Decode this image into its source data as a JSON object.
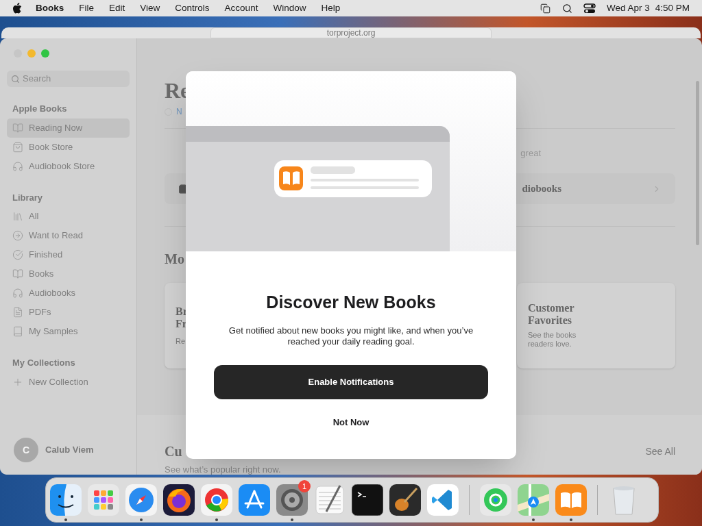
{
  "menu_bar": {
    "app": "Books",
    "items": [
      "File",
      "Edit",
      "View",
      "Controls",
      "Account",
      "Window",
      "Help"
    ],
    "date": "Wed Apr 3",
    "time": "4:50 PM"
  },
  "background_window": {
    "url": "torproject.org"
  },
  "sidebar": {
    "search": {
      "placeholder": "Search"
    },
    "sections": [
      {
        "title": "Apple Books",
        "items": [
          {
            "label": "Reading Now",
            "selected": true
          },
          {
            "label": "Book Store",
            "selected": false
          },
          {
            "label": "Audiobook Store",
            "selected": false
          }
        ]
      },
      {
        "title": "Library",
        "items": [
          {
            "label": "All",
            "selected": false
          },
          {
            "label": "Want to Read",
            "selected": false
          },
          {
            "label": "Finished",
            "selected": false
          },
          {
            "label": "Books",
            "selected": false
          },
          {
            "label": "Audiobooks",
            "selected": false
          },
          {
            "label": "PDFs",
            "selected": false
          },
          {
            "label": "My Samples",
            "selected": false
          }
        ]
      },
      {
        "title": "My Collections",
        "items": [
          {
            "label": "New Collection",
            "selected": false
          }
        ]
      }
    ],
    "user": {
      "initial": "C",
      "name": "Calub Viem"
    }
  },
  "content": {
    "heading": "Re",
    "link": "N",
    "intro_tail": "great",
    "store_row": "diobooks",
    "section_heading": "Mo",
    "card_left": {
      "title_lines": [
        "Br",
        "Fr"
      ],
      "text": "Re"
    },
    "card_right": {
      "title": "Customer Favorites",
      "text": "See the books readers love."
    },
    "bottom_heading": "Cu",
    "bottom_subtitle": "See what’s popular right now.",
    "see_all": "See All"
  },
  "dialog": {
    "title": "Discover New Books",
    "message": "Get notified about new books you might like, and when you’ve reached your daily reading goal.",
    "primary": "Enable Notifications",
    "secondary": "Not Now"
  },
  "dock": [
    {
      "running": true
    },
    {
      "running": false
    },
    {
      "running": true
    },
    {
      "running": false
    },
    {
      "running": true
    },
    {
      "running": false
    },
    {
      "running": true,
      "badge": "1"
    },
    {
      "running": false
    },
    {
      "running": false
    },
    {
      "running": false
    },
    {
      "running": false
    },
    {
      "running": false
    },
    {
      "running": true
    },
    {
      "running": true
    },
    {
      "running": false
    }
  ]
}
